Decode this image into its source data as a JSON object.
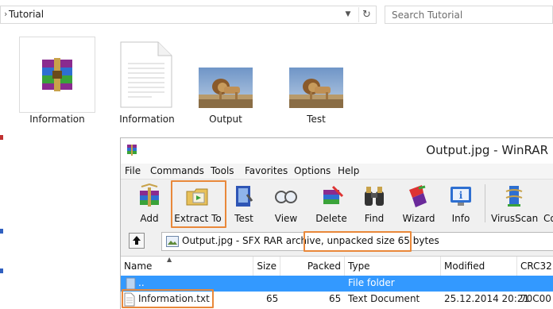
{
  "explorer": {
    "address": "Tutorial",
    "search_placeholder": "Search Tutorial",
    "files": [
      {
        "label": "Information"
      },
      {
        "label": "Information"
      },
      {
        "label": "Output"
      },
      {
        "label": "Test"
      }
    ]
  },
  "winrar": {
    "title": "Output.jpg - WinRAR",
    "menu": [
      "File",
      "Commands",
      "Tools",
      "Favorites",
      "Options",
      "Help"
    ],
    "toolbar": [
      "Add",
      "Extract To",
      "Test",
      "View",
      "Delete",
      "Find",
      "Wizard",
      "Info",
      "VirusScan",
      "Co"
    ],
    "path_text": "Output.jpg - SFX RAR archive, unpacked size 65 bytes",
    "columns": [
      "Name",
      "Size",
      "Packed",
      "Type",
      "Modified",
      "CRC32"
    ],
    "rows": [
      {
        "name": "..",
        "size": "",
        "packed": "",
        "type": "File folder",
        "modified": "",
        "crc": ""
      },
      {
        "name": "Information.txt",
        "size": "65",
        "packed": "65",
        "type": "Text Document",
        "modified": "25.12.2014 20:21",
        "crc": "70C00"
      }
    ],
    "highlight_color": "#e9883a",
    "selection_color": "#3399ff"
  }
}
